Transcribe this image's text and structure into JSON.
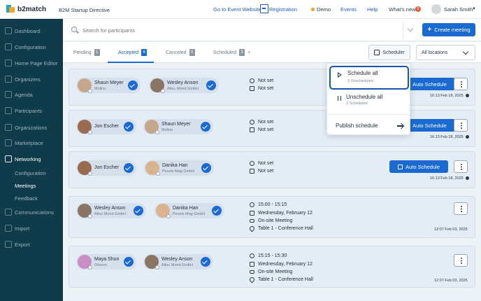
{
  "brand": {
    "logo_text": "b2match"
  },
  "header": {
    "event_title": "B2M Startup Directive",
    "go_to_event": "Go to Event Website",
    "registration": "Registration",
    "demo": "Demo",
    "events": "Events",
    "help": "Help",
    "whats_new": "What's new",
    "whats_new_count": "9",
    "user_name": "Sarah Smith"
  },
  "sidebar": {
    "items": [
      {
        "label": "Dashboard",
        "icon": "dashboard-icon"
      },
      {
        "label": "Configuration",
        "icon": "configuration-icon"
      },
      {
        "label": "Home Page Editor",
        "icon": "home-page-editor-icon"
      },
      {
        "label": "Organizers",
        "icon": "organizers-icon"
      },
      {
        "label": "Agenda",
        "icon": "agenda-icon"
      },
      {
        "label": "Participants",
        "icon": "participants-icon"
      },
      {
        "label": "Organizations",
        "icon": "organizations-icon"
      },
      {
        "label": "Marketplace",
        "icon": "marketplace-icon"
      },
      {
        "label": "Networking",
        "icon": "networking-icon"
      },
      {
        "label": "Communications",
        "icon": "communications-icon"
      },
      {
        "label": "Import",
        "icon": "import-icon"
      },
      {
        "label": "Export",
        "icon": "export-icon"
      }
    ],
    "networking_sub": [
      "Configuration",
      "Meetings",
      "Feedback"
    ]
  },
  "search": {
    "placeholder": "Search for participants"
  },
  "create_meeting": "Create meeting",
  "tabs": [
    {
      "label": "Pending",
      "count": "1"
    },
    {
      "label": "Accepted",
      "count": "6"
    },
    {
      "label": "Canceled",
      "count": "0"
    },
    {
      "label": "Scheduled",
      "count": "3"
    }
  ],
  "tab_plus": "+",
  "scheduler_label": "Scheduler",
  "location_select": "All locations",
  "meetings": [
    {
      "p1": {
        "name": "Shaun Meyer",
        "org": "Molino"
      },
      "p2": {
        "name": "Wesley Anson",
        "org": "Altuc Mond GmbH"
      },
      "line1": "Not set",
      "line2": "Not set",
      "button": "Auto Schedule",
      "stamp": "16:13 Feb 18, 2025"
    },
    {
      "p1": {
        "name": "Jon Escher",
        "org": ""
      },
      "p2": {
        "name": "Shaun Meyer",
        "org": "Molino"
      },
      "line1": "Not set",
      "line2": "Not set",
      "button": "Auto Schedule",
      "stamp": "16:13 Feb 18, 2025"
    },
    {
      "p1": {
        "name": "Jon Escher",
        "org": ""
      },
      "p2": {
        "name": "Danika Han",
        "org": "Pexels Mag GmbH"
      },
      "line1": "Not set",
      "line2": "Not set",
      "button": "Auto Schedule",
      "stamp": "16:13 Feb 18, 2025"
    },
    {
      "p1": {
        "name": "Wesley Anson",
        "org": "Altuc Mond GmbH"
      },
      "p2": {
        "name": "Danika Han",
        "org": "Pexels Mag GmbH"
      },
      "time": "15:00 - 15:15",
      "date": "Wednesday, February 12",
      "type": "On-site Meeting",
      "location": "Table 1 - Conference Hall",
      "stamp": "12:07 Feb 03, 2025"
    },
    {
      "p1": {
        "name": "Maya Shun",
        "org": "Orloom"
      },
      "p2": {
        "name": "Wesley Anson",
        "org": "Altuc Mond GmbH"
      },
      "time": "15:15 - 15:30",
      "date": "Wednesday, February 12",
      "type": "On-site Meeting",
      "location": "Table 1 - Conference Hall",
      "stamp": "12:07 Feb 03, 2025"
    }
  ],
  "popover": {
    "schedule_all": "Schedule all",
    "schedule_all_sub": "3 Unscheduled",
    "unschedule_all": "Unschedule all",
    "unschedule_all_sub": "3 Scheduled",
    "publish": "Publish schedule"
  },
  "colors": {
    "accent": "#1b6ad1",
    "sidebar": "#0f3b4a",
    "demo_dot": "#f0a020"
  }
}
